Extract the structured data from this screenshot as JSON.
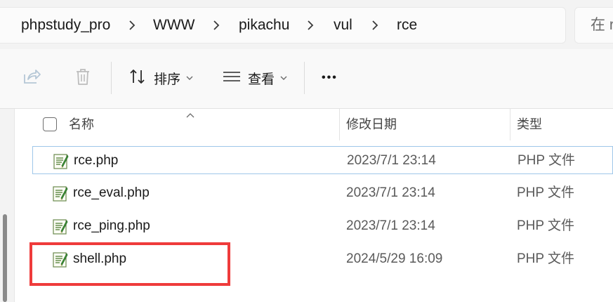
{
  "breadcrumb": {
    "items": [
      "phpstudy_pro",
      "WWW",
      "pikachu",
      "vul",
      "rce"
    ]
  },
  "search": {
    "placeholder": "在 r"
  },
  "toolbar": {
    "share_icon": "share-icon",
    "delete_icon": "trash-icon",
    "sort_label": "排序",
    "view_label": "查看",
    "more_label": "•••"
  },
  "file_list": {
    "columns": {
      "name": "名称",
      "date": "修改日期",
      "type": "类型"
    },
    "rows": [
      {
        "name": "rce.php",
        "date": "2023/7/1 23:14",
        "type": "PHP 文件"
      },
      {
        "name": "rce_eval.php",
        "date": "2023/7/1 23:14",
        "type": "PHP 文件"
      },
      {
        "name": "rce_ping.php",
        "date": "2023/7/1 23:14",
        "type": "PHP 文件"
      },
      {
        "name": "shell.php",
        "date": "2024/5/29 16:09",
        "type": "PHP 文件"
      }
    ]
  },
  "colors": {
    "highlight": "#ef3b3b",
    "selection_border": "#9fc7ea",
    "icon_green": "#3f9b3a"
  }
}
